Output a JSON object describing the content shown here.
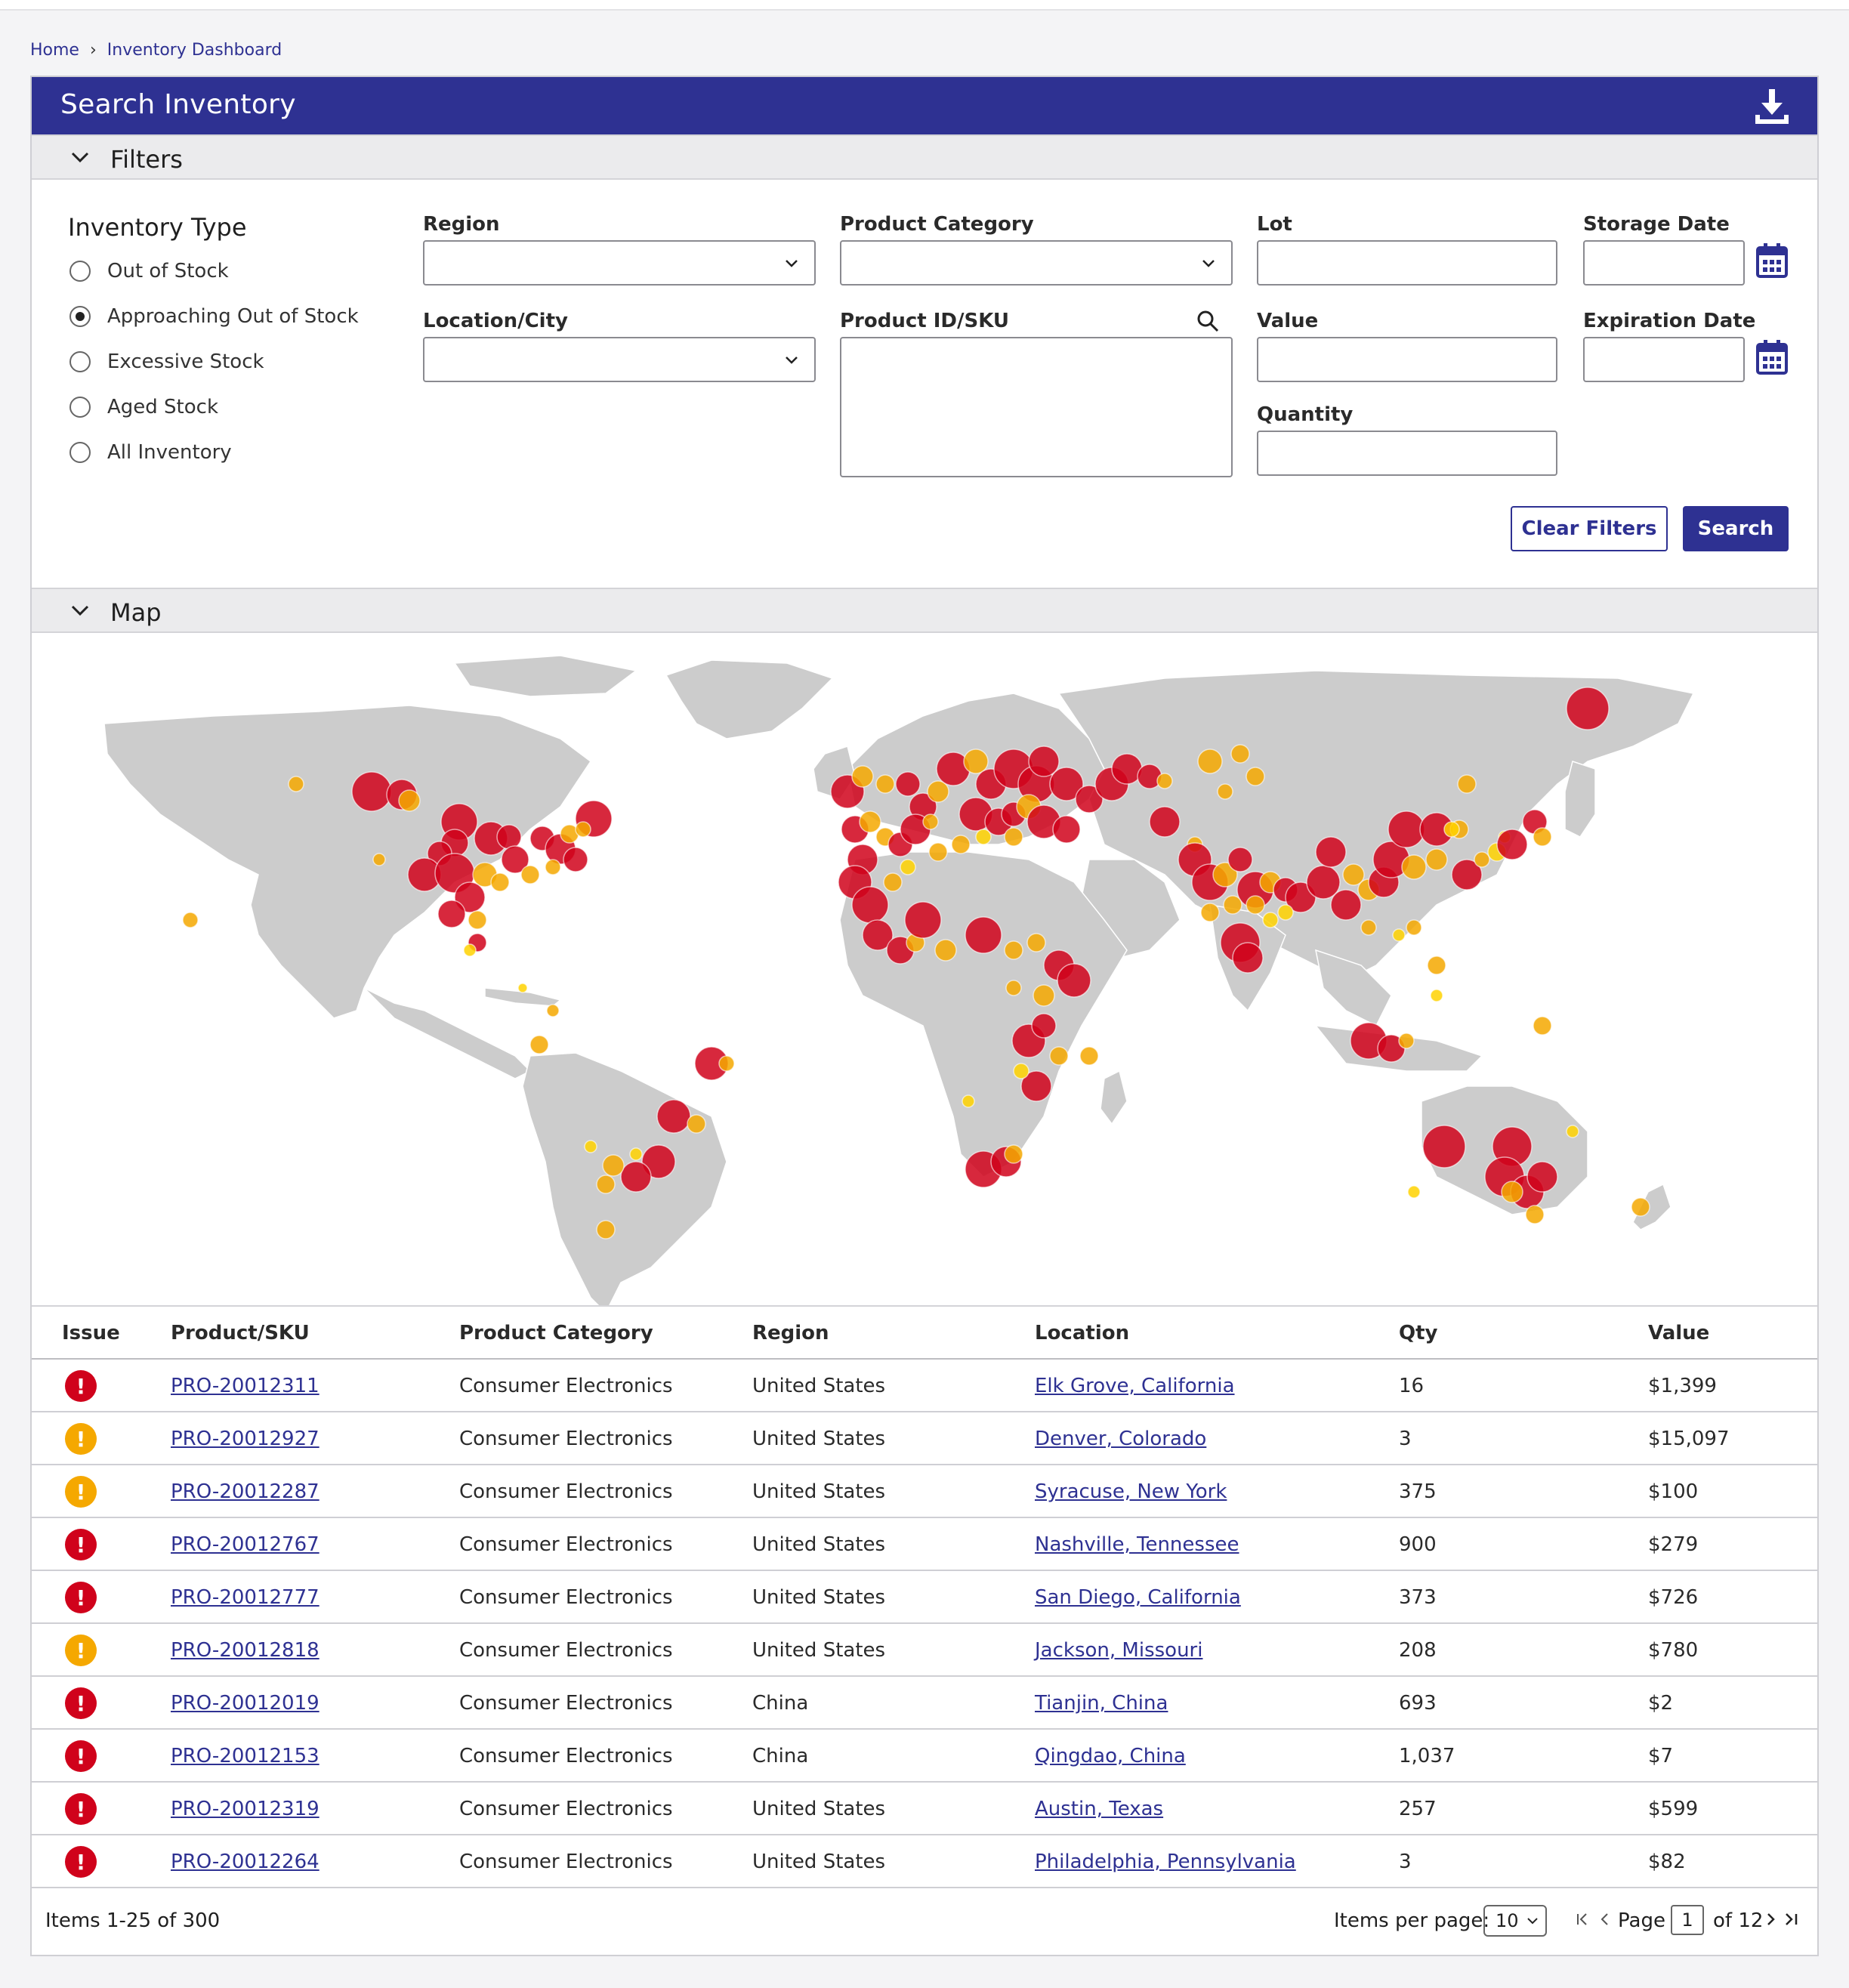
{
  "breadcrumb": {
    "home": "Home",
    "current": "Inventory Dashboard"
  },
  "header": {
    "title": "Search Inventory",
    "download_icon": "download-icon"
  },
  "filters": {
    "section_label": "Filters",
    "inventory_type": {
      "title": "Inventory Type",
      "options": [
        "Out of Stock",
        "Approaching Out of Stock",
        "Excessive Stock",
        "Aged Stock",
        "All Inventory"
      ],
      "selected": "Approaching Out of Stock"
    },
    "region": {
      "label": "Region",
      "value": ""
    },
    "location": {
      "label": "Location/City",
      "value": ""
    },
    "category": {
      "label": "Product Category",
      "value": ""
    },
    "product_id": {
      "label": "Product ID/SKU",
      "value": ""
    },
    "lot": {
      "label": "Lot",
      "value": ""
    },
    "value": {
      "label": "Value",
      "value": ""
    },
    "quantity": {
      "label": "Quantity",
      "value": ""
    },
    "storage_date": {
      "label": "Storage Date",
      "value": ""
    },
    "expiration_date": {
      "label": "Expiration Date",
      "value": ""
    },
    "clear_label": "Clear Filters",
    "search_label": "Search"
  },
  "map": {
    "section_label": "Map",
    "colors": {
      "land": "#cccccc",
      "critical": "#d0021b",
      "warning": "#f5a800",
      "minor": "#ffd200"
    }
  },
  "table": {
    "columns": [
      "Issue",
      "Product/SKU",
      "Product Category",
      "Region",
      "Location",
      "Qty",
      "Value"
    ],
    "rows": [
      {
        "issue": "critical",
        "sku": "PRO-20012311",
        "category": "Consumer Electronics",
        "region": "United States",
        "location": "Elk Grove, California",
        "qty": "16",
        "value": "$1,399"
      },
      {
        "issue": "warning",
        "sku": "PRO-20012927",
        "category": "Consumer Electronics",
        "region": "United States",
        "location": "Denver, Colorado",
        "qty": "3",
        "value": "$15,097"
      },
      {
        "issue": "warning",
        "sku": "PRO-20012287",
        "category": "Consumer Electronics",
        "region": "United States",
        "location": "Syracuse, New York",
        "qty": "375",
        "value": "$100"
      },
      {
        "issue": "critical",
        "sku": "PRO-20012767",
        "category": "Consumer Electronics",
        "region": "United States",
        "location": "Nashville, Tennessee",
        "qty": "900",
        "value": "$279"
      },
      {
        "issue": "critical",
        "sku": "PRO-20012777",
        "category": "Consumer Electronics",
        "region": "United States",
        "location": "San Diego, California",
        "qty": "373",
        "value": "$726"
      },
      {
        "issue": "warning",
        "sku": "PRO-20012818",
        "category": "Consumer Electronics",
        "region": "United States",
        "location": "Jackson, Missouri",
        "qty": "208",
        "value": "$780"
      },
      {
        "issue": "critical",
        "sku": "PRO-20012019",
        "category": "Consumer Electronics",
        "region": "China",
        "location": "Tianjin, China",
        "qty": "693",
        "value": "$2"
      },
      {
        "issue": "critical",
        "sku": "PRO-20012153",
        "category": "Consumer Electronics",
        "region": "China",
        "location": "Qingdao, China",
        "qty": "1,037",
        "value": "$7"
      },
      {
        "issue": "critical",
        "sku": "PRO-20012319",
        "category": "Consumer Electronics",
        "region": "United States",
        "location": "Austin, Texas",
        "qty": "257",
        "value": "$599"
      },
      {
        "issue": "critical",
        "sku": "PRO-20012264",
        "category": "Consumer Electronics",
        "region": "United States",
        "location": "Philadelphia, Pennsylvania",
        "qty": "3",
        "value": "$82"
      }
    ]
  },
  "pagination": {
    "items_text": "Items 1-25 of 300",
    "per_page_label": "Items per page:",
    "per_page_value": "10",
    "page_label": "Page",
    "page_value": "1",
    "of_label": "of 12"
  }
}
